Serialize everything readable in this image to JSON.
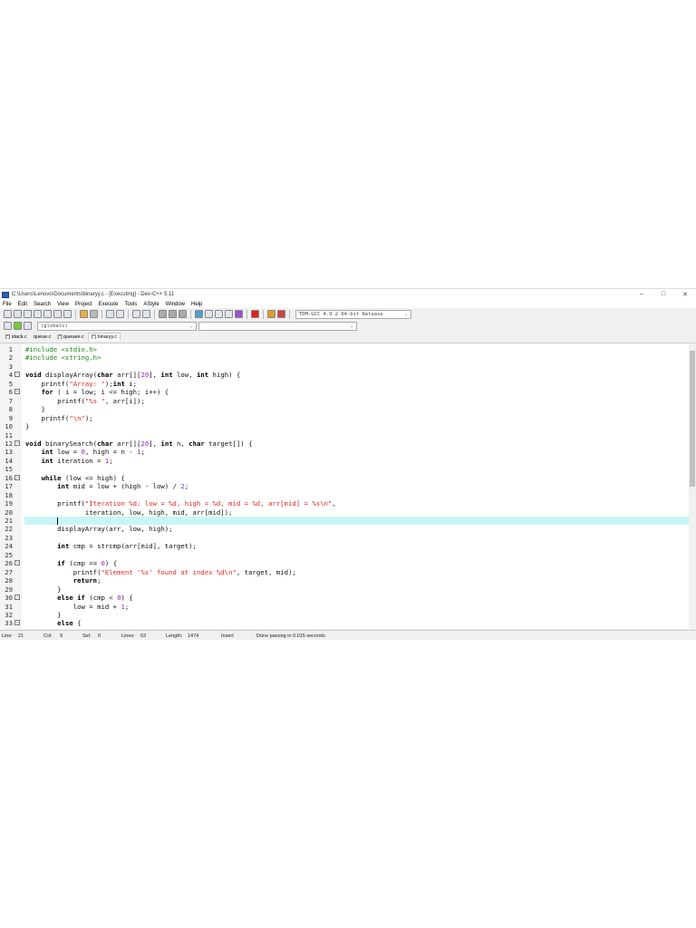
{
  "window": {
    "title": "C:\\Users\\Lenovo\\Documents\\binaryy.c - [Executing] - Dev-C++ 5.11",
    "controls": [
      "–",
      "□",
      "✕"
    ]
  },
  "menu": [
    "File",
    "Edit",
    "Search",
    "View",
    "Project",
    "Execute",
    "Tools",
    "AStyle",
    "Window",
    "Help"
  ],
  "compiler": "TDM-GCC 4.9.2 64-bit Release",
  "scope": "(globals)",
  "tabs": [
    "[*] stack.c",
    "queue.c",
    "[*] queuee.c",
    "[*] binaryy.c"
  ],
  "active_tab": 3,
  "editor": {
    "current_line": 21,
    "lines": [
      {
        "n": "1",
        "fold": "",
        "s": [
          [
            "pp",
            "#include <stdio.h>"
          ]
        ]
      },
      {
        "n": "2",
        "fold": "",
        "s": [
          [
            "pp",
            "#include <string.h>"
          ]
        ]
      },
      {
        "n": "3",
        "fold": "",
        "s": []
      },
      {
        "n": "4",
        "fold": "-",
        "s": [
          [
            "kw",
            "void"
          ],
          [
            "pl",
            " displayArray("
          ],
          [
            "kw",
            "char"
          ],
          [
            "pl",
            " arr[]["
          ],
          [
            "num",
            "20"
          ],
          [
            "pl",
            "], "
          ],
          [
            "kw",
            "int"
          ],
          [
            "pl",
            " low, "
          ],
          [
            "kw",
            "int"
          ],
          [
            "pl",
            " high) {"
          ]
        ]
      },
      {
        "n": "5",
        "fold": "",
        "s": [
          [
            "pl",
            "    printf("
          ],
          [
            "str",
            "\"Array: \""
          ],
          [
            "pl",
            ");"
          ],
          [
            "kw",
            "int"
          ],
          [
            "pl",
            " i;"
          ]
        ]
      },
      {
        "n": "6",
        "fold": "-",
        "s": [
          [
            "pl",
            "    "
          ],
          [
            "kw",
            "for"
          ],
          [
            "pl",
            " ( i = low; i <= high; i++) {"
          ]
        ]
      },
      {
        "n": "7",
        "fold": "",
        "s": [
          [
            "pl",
            "        printf("
          ],
          [
            "str",
            "\"%s \""
          ],
          [
            "pl",
            ", arr[i]);"
          ]
        ]
      },
      {
        "n": "8",
        "fold": "",
        "s": [
          [
            "pl",
            "    }"
          ]
        ]
      },
      {
        "n": "9",
        "fold": "",
        "s": [
          [
            "pl",
            "    printf("
          ],
          [
            "str",
            "\"\\n\""
          ],
          [
            "pl",
            ");"
          ]
        ]
      },
      {
        "n": "10",
        "fold": "",
        "s": [
          [
            "pl",
            "}"
          ]
        ]
      },
      {
        "n": "11",
        "fold": "",
        "s": []
      },
      {
        "n": "12",
        "fold": "-",
        "s": [
          [
            "kw",
            "void"
          ],
          [
            "pl",
            " binarySearch("
          ],
          [
            "kw",
            "char"
          ],
          [
            "pl",
            " arr[]["
          ],
          [
            "num",
            "20"
          ],
          [
            "pl",
            "], "
          ],
          [
            "kw",
            "int"
          ],
          [
            "pl",
            " n, "
          ],
          [
            "kw",
            "char"
          ],
          [
            "pl",
            " target[]) {"
          ]
        ]
      },
      {
        "n": "13",
        "fold": "",
        "s": [
          [
            "pl",
            "    "
          ],
          [
            "kw",
            "int"
          ],
          [
            "pl",
            " low = "
          ],
          [
            "num",
            "0"
          ],
          [
            "pl",
            ", high = n - "
          ],
          [
            "num",
            "1"
          ],
          [
            "pl",
            ";"
          ]
        ]
      },
      {
        "n": "14",
        "fold": "",
        "s": [
          [
            "pl",
            "    "
          ],
          [
            "kw",
            "int"
          ],
          [
            "pl",
            " iteration = "
          ],
          [
            "num",
            "1"
          ],
          [
            "pl",
            ";"
          ]
        ]
      },
      {
        "n": "15",
        "fold": "",
        "s": []
      },
      {
        "n": "16",
        "fold": "-",
        "s": [
          [
            "pl",
            "    "
          ],
          [
            "kw",
            "while"
          ],
          [
            "pl",
            " (low <= high) {"
          ]
        ]
      },
      {
        "n": "17",
        "fold": "",
        "s": [
          [
            "pl",
            "        "
          ],
          [
            "kw",
            "int"
          ],
          [
            "pl",
            " mid = low + (high - low) / "
          ],
          [
            "num",
            "2"
          ],
          [
            "pl",
            ";"
          ]
        ]
      },
      {
        "n": "18",
        "fold": "",
        "s": []
      },
      {
        "n": "19",
        "fold": "",
        "s": [
          [
            "pl",
            "        printf("
          ],
          [
            "str",
            "\"Iteration %d: low = %d, high = %d, mid = %d, arr[mid] = %s\\n\""
          ],
          [
            "pl",
            ","
          ]
        ]
      },
      {
        "n": "20",
        "fold": "",
        "s": [
          [
            "pl",
            "               iteration, low, high, mid, arr[mid]);"
          ]
        ]
      },
      {
        "n": "21",
        "fold": "",
        "s": [
          [
            "pl",
            "        "
          ]
        ]
      },
      {
        "n": "22",
        "fold": "",
        "s": [
          [
            "pl",
            "        displayArray(arr, low, high);"
          ]
        ]
      },
      {
        "n": "23",
        "fold": "",
        "s": []
      },
      {
        "n": "24",
        "fold": "",
        "s": [
          [
            "pl",
            "        "
          ],
          [
            "kw",
            "int"
          ],
          [
            "pl",
            " cmp = strcmp(arr[mid], target);"
          ]
        ]
      },
      {
        "n": "25",
        "fold": "",
        "s": []
      },
      {
        "n": "26",
        "fold": "-",
        "s": [
          [
            "pl",
            "        "
          ],
          [
            "kw",
            "if"
          ],
          [
            "pl",
            " (cmp == "
          ],
          [
            "num",
            "0"
          ],
          [
            "pl",
            ") {"
          ]
        ]
      },
      {
        "n": "27",
        "fold": "",
        "s": [
          [
            "pl",
            "            printf("
          ],
          [
            "str",
            "\"Element '%s' found at index %d\\n\""
          ],
          [
            "pl",
            ", target, mid);"
          ]
        ]
      },
      {
        "n": "28",
        "fold": "",
        "s": [
          [
            "pl",
            "            "
          ],
          [
            "kw",
            "return"
          ],
          [
            "pl",
            ";"
          ]
        ]
      },
      {
        "n": "29",
        "fold": "",
        "s": [
          [
            "pl",
            "        }"
          ]
        ]
      },
      {
        "n": "30",
        "fold": "-",
        "s": [
          [
            "pl",
            "        "
          ],
          [
            "kw",
            "else if"
          ],
          [
            "pl",
            " (cmp < "
          ],
          [
            "num",
            "0"
          ],
          [
            "pl",
            ") {"
          ]
        ]
      },
      {
        "n": "31",
        "fold": "",
        "s": [
          [
            "pl",
            "            low = mid + "
          ],
          [
            "num",
            "1"
          ],
          [
            "pl",
            ";"
          ]
        ]
      },
      {
        "n": "32",
        "fold": "",
        "s": [
          [
            "pl",
            "        }"
          ]
        ]
      },
      {
        "n": "33",
        "fold": "-",
        "s": [
          [
            "pl",
            "        "
          ],
          [
            "kw",
            "else"
          ],
          [
            "pl",
            " {"
          ]
        ]
      }
    ]
  },
  "status": {
    "line": "Line:",
    "line_val": "21",
    "col": "Col:",
    "col_val": "9",
    "sel": "Sel:",
    "sel_val": "0",
    "lines": "Lines:",
    "lines_val": "63",
    "length": "Length:",
    "length_val": "1474",
    "mode": "Insert",
    "message": "Done parsing in 0.015 seconds"
  }
}
